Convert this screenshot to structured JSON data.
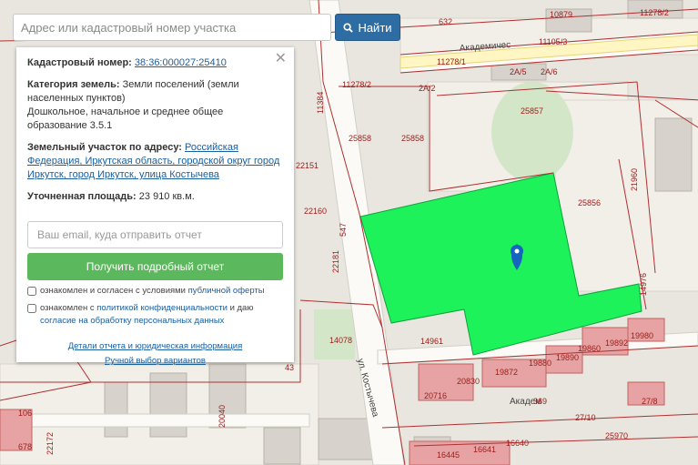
{
  "search": {
    "placeholder": "Адрес или кадастровый номер участка",
    "button_label": "Найти"
  },
  "panel": {
    "cadastral_label": "Кадастровый номер:",
    "cadastral_value": "38:36:000027:25410",
    "category_label": "Категория земель:",
    "category_value": "Земли поселений (земли населенных пунктов)",
    "category_use": "Дошкольное, начальное и среднее общее образование 3.5.1",
    "address_label": "Земельный участок по адресу:",
    "address_value": "Российская Федерация, Иркутская область, городской округ город Иркутск, город Иркутск, улица Костычева",
    "area_label": "Уточненная площадь:",
    "area_value": "23 910 кв.м.",
    "email_placeholder": "Ваш email, куда отправить отчет",
    "report_button": "Получить подробный отчет",
    "consent1_text": "ознакомлен и согласен с условиями",
    "consent1_link": "публичной оферты",
    "consent2_text1": "ознакомлен с",
    "consent2_link1": "политикой конфиденциальности",
    "consent2_text2": "и даю",
    "consent2_link2": "согласие на обработку персональных данных",
    "details_link": "Детали отчета и юридическая информация",
    "manual_link": "Ручной выбор вариантов"
  },
  "map": {
    "parcel_color": "#1ef25a",
    "marker_color": "#1565c0",
    "streets": [
      "Академичес",
      "ул. Костычева",
      "Академ"
    ],
    "labels": [
      "632",
      "10879",
      "11278/2",
      "11105/3",
      "11278/1",
      "2А/5",
      "2А/6",
      "11278/2",
      "2А/2",
      "11384",
      "25857",
      "25858",
      "25858",
      "22151",
      "25856",
      "21960",
      "22160",
      "22181",
      "14976",
      "14078",
      "14961",
      "19980",
      "19892",
      "19860",
      "19890",
      "19880",
      "19872",
      "20830",
      "20716",
      "369",
      "27/8",
      "27/10",
      "25970",
      "16445",
      "16641",
      "16640",
      "20040",
      "106",
      "678",
      "22172",
      "43",
      "547"
    ]
  }
}
